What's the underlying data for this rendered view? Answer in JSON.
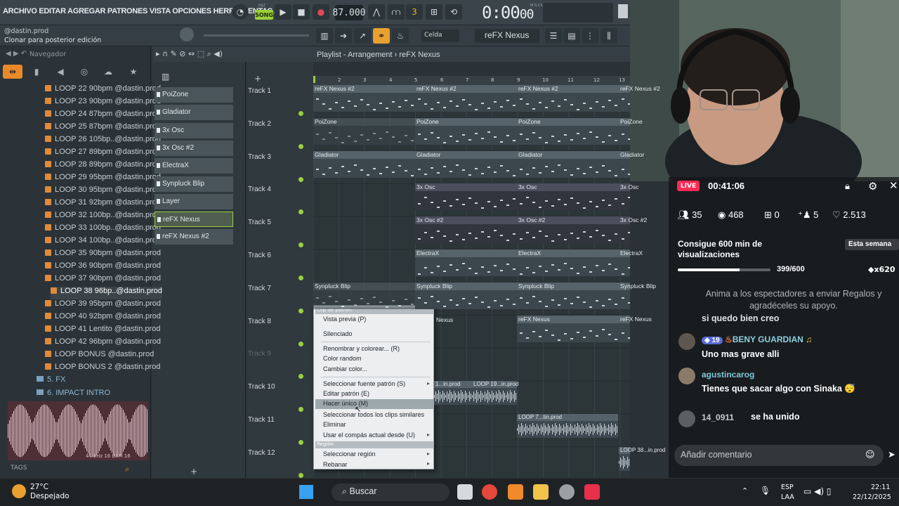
{
  "toolbar": {
    "menus": "ARCHIVO EDITAR AGREGAR PATRONES VISTA OPCIONES HERRAMIENTAS AYU",
    "pat_label": "PAT",
    "song_label": "SONG",
    "tempo": "87.000",
    "time_main": "0:00",
    "time_sub": "00",
    "time_unit": "M:S:CS"
  },
  "hintbar": {
    "user": "@dastin.prod",
    "hint": "Clonar para posterior edición",
    "snap": "Celda",
    "pattern": "reFX Nexus"
  },
  "browser": {
    "title": "Navegador",
    "items": [
      "LOOP 22 90bpm @dastin.prod",
      "LOOP 23 90bpm @dastin.prod",
      "LOOP 24 87bpm @dastin.prod",
      "LOOP 25 87bpm @dastin.prod",
      "LOOP 26 105bp..@dastin.prod",
      "LOOP 27 89bpm @dastin.prod",
      "LOOP 28 89bpm @dastin.prod",
      "LOOP 29 95bpm @dastin.prod",
      "LOOP 30 95bpm @dastin.prod",
      "LOOP 31 92bpm @dastin.prod",
      "LOOP 32 100bp..@dastin.prod",
      "LOOP 33 100bp..@dastin.prod",
      "LOOP 34 100bp..@dastin.prod",
      "LOOP 35 90bpm @dastin.prod",
      "LOOP 36 90bpm @dastin.prod",
      "LOOP 37 90bpm @dastin.prod",
      "LOOP 38 96bp..@dastin.prod",
      "LOOP 39 95bpm @dastin.prod",
      "LOOP 40 92bpm @dastin.prod",
      "LOOP 41 Lentito @dastin.prod",
      "LOOP 42 96bpm @dastin.prod",
      "LOOP BONUS @dastin.prod",
      "LOOP BONUS 2 @dastin.prod"
    ],
    "selected_index": 16,
    "folders": [
      "5. FX",
      "6. IMPACT INTRO"
    ],
    "wave_info": "44 kHz 16 BPM 16",
    "tags_label": "TAGS"
  },
  "patterns": [
    "PoiZone",
    "Gladiator",
    "3x Osc",
    "3x Osc #2",
    "ElectraX",
    "Synpluck Blip",
    "Layer",
    "reFX Nexus",
    "reFX Nexus #2"
  ],
  "selected_pattern": 7,
  "playlist": {
    "title": "Playlist - Arrangement",
    "pattern": "reFX Nexus",
    "ruler": [
      "2",
      "3",
      "4",
      "5",
      "6",
      "7",
      "8",
      "9",
      "10",
      "11",
      "12",
      "13"
    ],
    "tracks": [
      "Track 1",
      "Track 2",
      "Track 3",
      "Track 4",
      "Track 5",
      "Track 6",
      "Track 7",
      "Track 8",
      "Track 9",
      "Track 10",
      "Track 11",
      "Track 12"
    ],
    "clip_labels": {
      "t1": "reFX Nexus #2",
      "t2": "PoiZone",
      "t3": "Gladiator",
      "t4": "3x Osc",
      "t5": "3x Osc #2",
      "t6": "ElectraX",
      "t7": "Synpluck Blip",
      "t8": "reFX Nexus",
      "t8a": "Nexus",
      "t10a": "1...in.prod",
      "t10b": "LOOP 19...in.prod",
      "t11": "LOOP 7...tin.prod",
      "t12": "LOOP 38...in.prod"
    }
  },
  "context_menu": {
    "section_clip": "Clip de patrón",
    "preview": "Vista previa (P)",
    "mute": "Silenciado",
    "rename": "Renombrar y colorear... (R)",
    "random_color": "Color random",
    "change_color": "Cambiar color...",
    "select_source": "Seleccionar fuente patrón (S)",
    "edit_pattern": "Editar patrón (E)",
    "make_unique": "Hacer único (M)",
    "select_similar": "Seleccionar todos los clips similares",
    "delete": "Eliminar",
    "use_measure": "Usar el compás actual desde (U)",
    "section_region": "Región",
    "select_region": "Seleccionar región",
    "slice": "Rebanar"
  },
  "live": {
    "badge": "LIVE",
    "time": "00:41:06",
    "viewers": "35",
    "views": "468",
    "gifts": "0",
    "joins": "5",
    "likes": "2.513",
    "goal_title": "Consigue 600 min de visualizaciones",
    "goal_week": "Esta semana",
    "goal_count": "399/600",
    "goal_progress": 0.665,
    "goal_gift": "x620",
    "encourage": "Anima a los espectadores a enviar Regalos y agradéceles su apoyo.",
    "partial_msg": "si quedo bien creo",
    "chat": [
      {
        "name": "BENY GUARDIAN",
        "level": "19",
        "msg": "Uno mas grave alli"
      },
      {
        "name": "agustincarog",
        "msg": "Tienes que sacar algo con Sinaka 😴"
      },
      {
        "name": "14_0911",
        "msg": "se ha unido"
      }
    ],
    "comment_placeholder": "Añadir comentario"
  },
  "taskbar": {
    "temp": "27°C",
    "weather": "Despejado",
    "search": "Buscar",
    "lang1": "ESP",
    "lang2": "LAA",
    "time": "22:11",
    "date": "22/12/2025"
  }
}
